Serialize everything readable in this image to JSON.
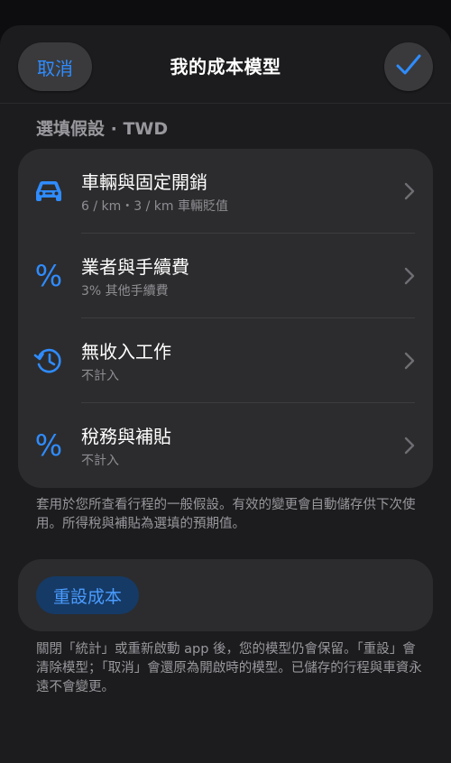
{
  "header": {
    "cancel_label": "取消",
    "title": "我的成本模型",
    "confirm_icon": "checkmark-icon"
  },
  "section": {
    "title": "選填假設 · TWD"
  },
  "rows": [
    {
      "title": "車輛與固定開銷",
      "subtitle": "6 / km・3 / km 車輛貶值",
      "icon": "car-icon"
    },
    {
      "title": "業者與手續費",
      "subtitle": "3% 其他手續費",
      "icon": "percent-icon"
    },
    {
      "title": "無收入工作",
      "subtitle": "不計入",
      "icon": "history-clock-icon"
    },
    {
      "title": "稅務與補貼",
      "subtitle": "不計入",
      "icon": "percent-icon"
    }
  ],
  "percent_glyph": "%",
  "footnote_1": "套用於您所查看行程的一般假設。有效的變更會自動儲存供下次使用。所得稅與補貼為選填的預期值。",
  "reset": {
    "label": "重設成本"
  },
  "footnote_2": "關閉「統計」或重新啟動 app 後，您的模型仍會保留。「重設」會清除模型；「取消」會還原為開啟時的模型。已儲存的行程與車資永遠不會變更。",
  "colors": {
    "accent": "#2f8cff",
    "background": "#1c1c1e",
    "card": "#2c2c2e",
    "secondary_text": "#98989d"
  }
}
